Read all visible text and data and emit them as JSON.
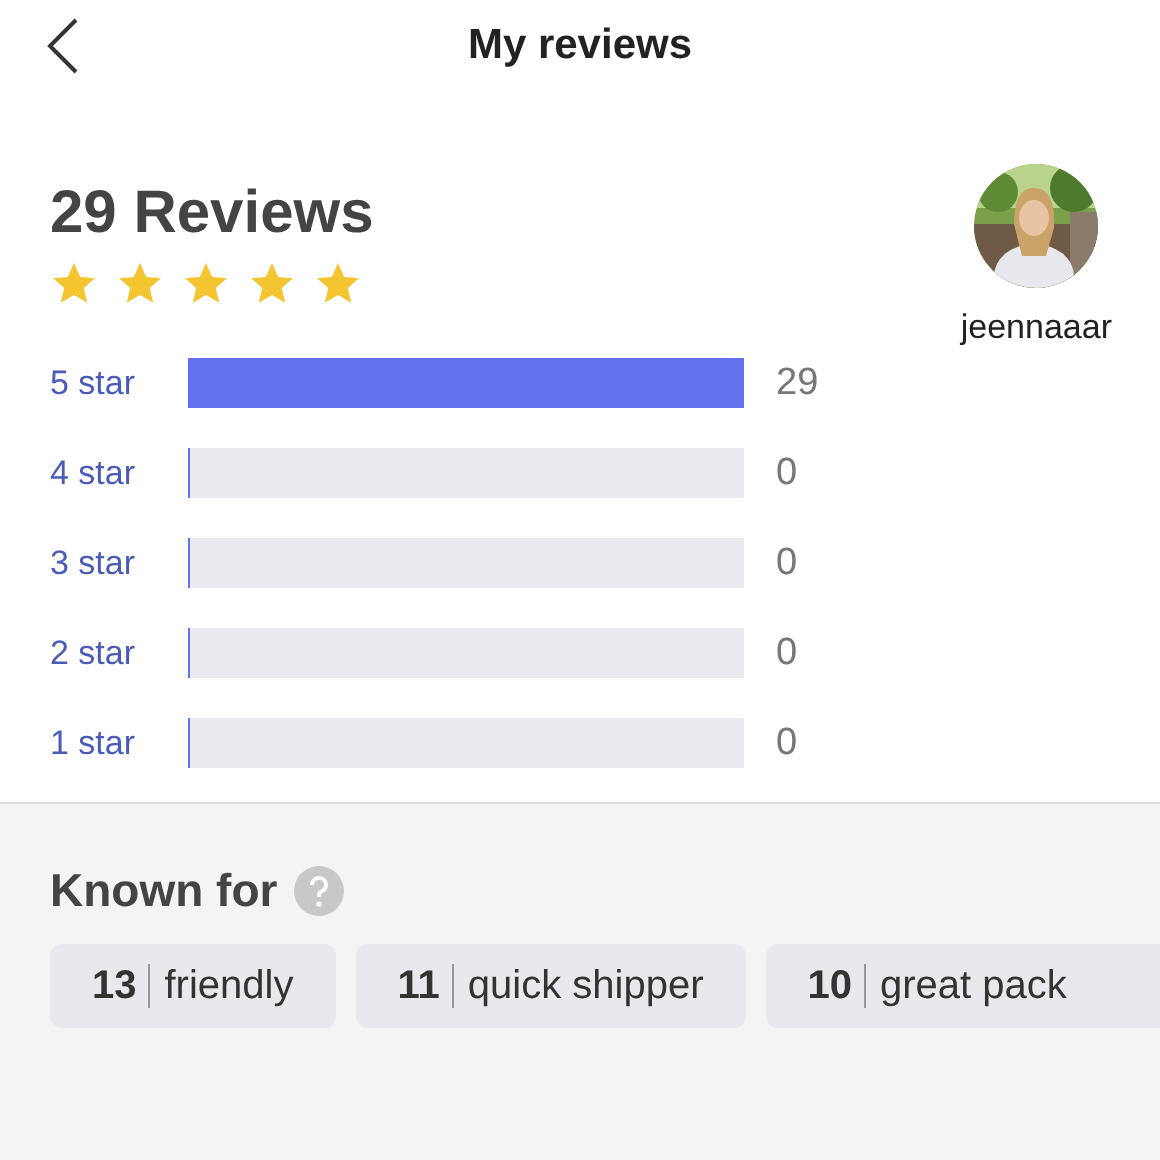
{
  "header": {
    "title": "My reviews"
  },
  "summary": {
    "title": "29 Reviews",
    "stars": 5
  },
  "profile": {
    "username": "jeennaaar"
  },
  "breakdown": [
    {
      "label": "5 star",
      "level": 1,
      "count": "29"
    },
    {
      "label": "4 star",
      "level": 0,
      "count": "0"
    },
    {
      "label": "3 star",
      "level": 0,
      "count": "0"
    },
    {
      "label": "2 star",
      "level": 0,
      "count": "0"
    },
    {
      "label": "1 star",
      "level": 0,
      "count": "0"
    }
  ],
  "known_for": {
    "title": "Known for",
    "tags": [
      {
        "count": "13",
        "label": "friendly"
      },
      {
        "count": "11",
        "label": "quick shipper"
      },
      {
        "count": "10",
        "label": "great pack"
      }
    ]
  }
}
